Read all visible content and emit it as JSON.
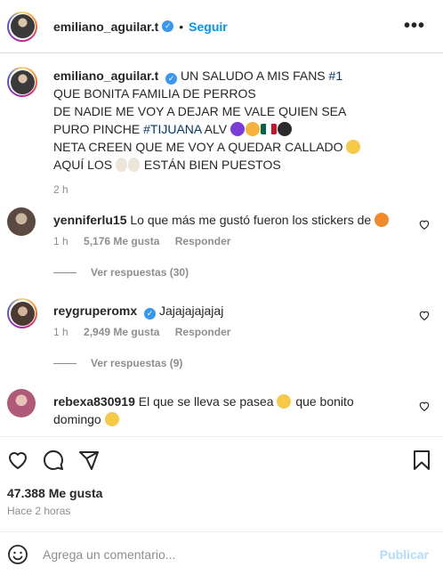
{
  "header": {
    "username": "emiliano_aguilar.t",
    "separator": "•",
    "follow_label": "Seguir",
    "more_icon": "more-horizontal-icon",
    "more_glyph": "•••"
  },
  "caption": {
    "username": "emiliano_aguilar.t",
    "line1": "UN SALUDO A MIS FANS",
    "line1_tag": "#1",
    "line2": "QUE BONITA FAMILIA DE PERROS",
    "line3": "DE NADIE ME VOY A DEJAR ME VALE QUIEN SEA",
    "line4_pre": "PURO PINCHE",
    "line4_tag": "#TIJUANA",
    "line4_post": "ALV",
    "line5": "NETA CREEN QUE ME VOY A QUEDAR CALLADO",
    "line6_pre": "AQUÍ LOS",
    "line6_post": "ESTÁN BIEN PUESTOS",
    "time": "2 h"
  },
  "comments": [
    {
      "username": "yenniferlu15",
      "text": "Lo que más me gustó fueron los stickers de",
      "time": "1 h",
      "likes": "5,176 Me gusta",
      "reply": "Responder",
      "view_replies": "Ver respuestas (30)"
    },
    {
      "username": "reygruperomx",
      "text": "Jajajajajajaj",
      "time": "1 h",
      "likes": "2,949 Me gusta",
      "reply": "Responder",
      "view_replies": "Ver respuestas (9)"
    },
    {
      "username": "rebexa830919",
      "text": "El que se lleva se pasea",
      "text2": "que bonito",
      "text3": "domingo"
    }
  ],
  "actions": {
    "like_icon": "heart-icon",
    "comment_icon": "comment-icon",
    "share_icon": "share-icon",
    "save_icon": "bookmark-icon",
    "likes": "47.388 Me gusta",
    "ago": "Hace 2 horas"
  },
  "add_comment": {
    "emoji_icon": "smile-icon",
    "placeholder": "Agrega un comentario...",
    "publish_label": "Publicar"
  },
  "colors": {
    "accent": "#0095f6",
    "hashtag": "#00376b",
    "muted": "#8e8e8e",
    "publish_disabled": "#b3dbff"
  }
}
